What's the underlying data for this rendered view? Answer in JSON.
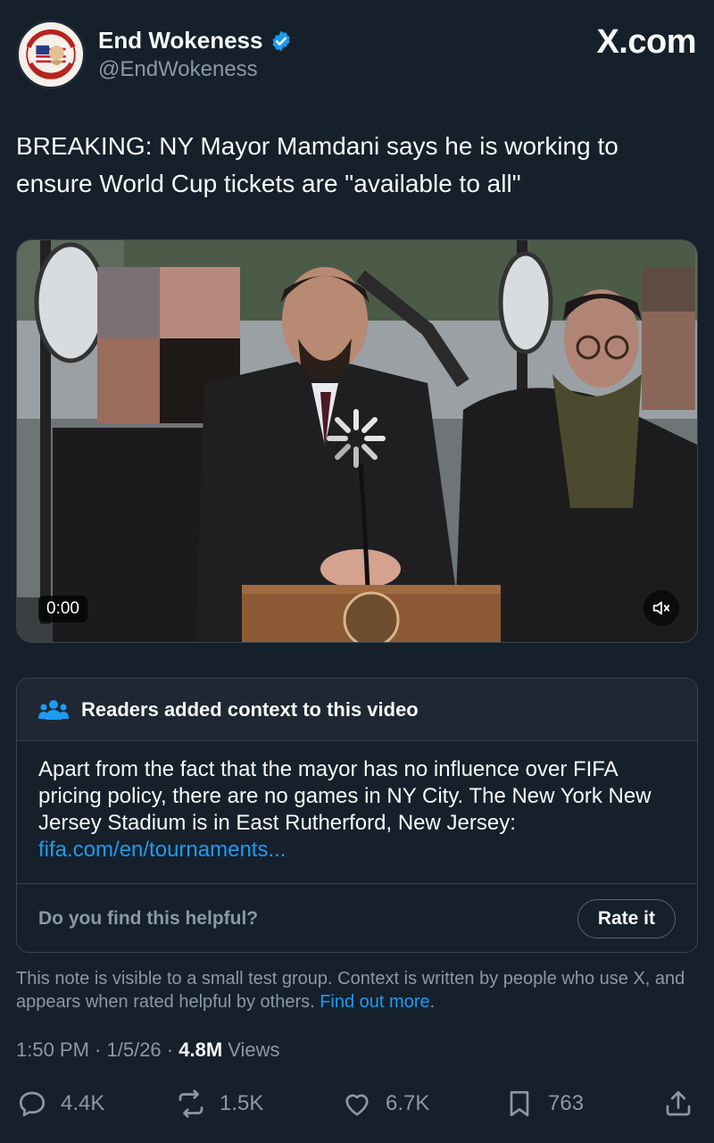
{
  "header": {
    "display_name": "End Wokeness",
    "handle": "@EndWokeness",
    "brand": "X.com",
    "avatar_text": "I SUPPORT THE FORMER THING",
    "verified_color": "#1d9bf0"
  },
  "tweet": {
    "text": "BREAKING: NY Mayor Mamdani says he is working to ensure World Cup tickets are \"available to all\""
  },
  "video": {
    "time": "0:00",
    "state": "loading",
    "icons": [
      "spinner-icon",
      "mute-icon"
    ]
  },
  "note": {
    "title": "Readers added context to this video",
    "body": "Apart from the fact that the mayor has no influence over FIFA pricing policy, there are no games in NY City. The New York New Jersey Stadium is in East Rutherford, New Jersey: ",
    "link": "fifa.com/en/tournaments...",
    "question": "Do you find this helpful?",
    "rate_label": "Rate it"
  },
  "disclaimer": {
    "text": "This note is visible to a small test group. Context is written by people who use X, and appears when rated helpful by others. ",
    "link": "Find out more",
    "end": "."
  },
  "meta": {
    "time": "1:50 PM",
    "sep1": " · ",
    "date": "1/5/26",
    "sep2": " · ",
    "views_count": "4.8M",
    "views_label": " Views"
  },
  "actions": {
    "replies": "4.4K",
    "reposts": "1.5K",
    "likes": "6.7K",
    "bookmarks": "763"
  },
  "colors": {
    "background": "#15202b",
    "muted": "#8b98a5",
    "accent": "#1d9bf0",
    "border": "#38444d"
  }
}
